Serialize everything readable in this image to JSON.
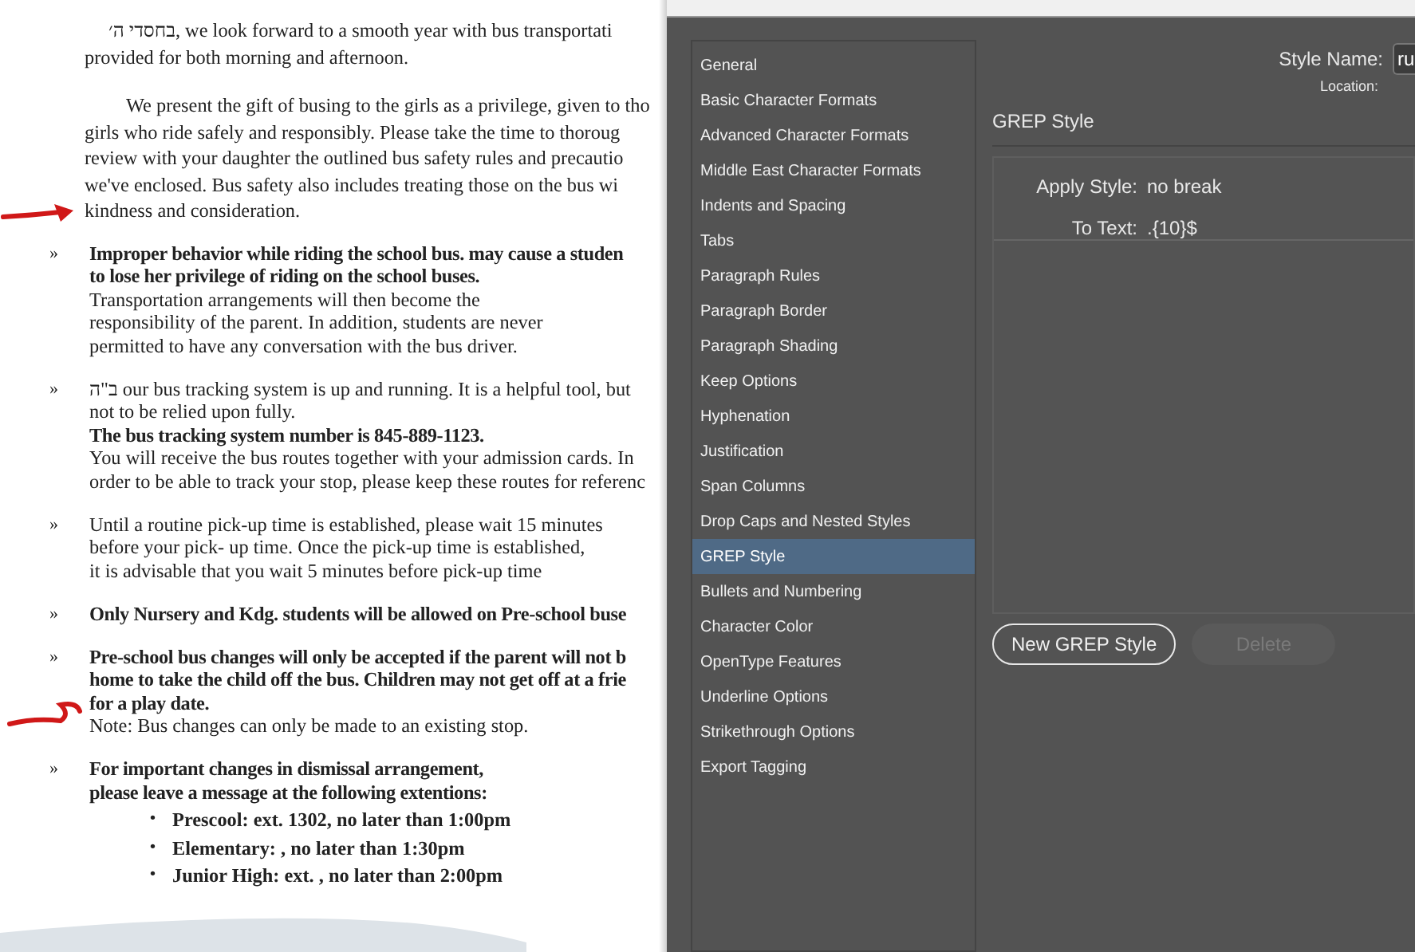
{
  "document": {
    "paragraphs": [
      {
        "lines": [
          "בחסדי ה׳, we look forward to a smooth year with bus transportati",
          "provided for both morning and afternoon."
        ]
      },
      {
        "lines": [
          "We present the gift of busing to the girls as a privilege, given to tho",
          "girls who ride safely and responsibly.  Please take the time to thoroug",
          "review with your daughter the outlined bus safety rules and precautio",
          "we've enclosed. Bus safety also includes treating those on the bus wi",
          "kindness and consideration."
        ]
      }
    ],
    "items": [
      {
        "marker": "»",
        "lines": [
          {
            "text": "Improper behavior while riding the school bus. may cause a studen",
            "bold": true
          },
          {
            "text": "to lose her privilege of riding on the school buses.",
            "bold": true
          },
          {
            "text": "Transportation arrangements will then become the",
            "bold": false
          },
          {
            "text": "responsibility of the parent.  In addition, students are never",
            "bold": false
          },
          {
            "text": "permitted to have any conversation with the bus driver.",
            "bold": false
          }
        ]
      },
      {
        "marker": "»",
        "lines": [
          {
            "text": "ב\"ה our bus tracking system is up and running. It is a helpful tool, but",
            "bold": false
          },
          {
            "text": "not to be relied upon fully.",
            "bold": false
          },
          {
            "text": "The bus tracking system number is 845-889-1123.",
            "bold": true
          },
          {
            "text": "You will receive the bus routes together with your admission cards.  In",
            "bold": false
          },
          {
            "text": "order to be able to track your stop, please keep these routes for referenc",
            "bold": false
          }
        ]
      },
      {
        "marker": "»",
        "lines": [
          {
            "text": "Until a routine pick-up time is established, please wait 15 minutes",
            "bold": false
          },
          {
            "text": "before your pick- up time.  Once the pick-up time is established,",
            "bold": false
          },
          {
            "text": "it is advisable that you wait 5 minutes before pick-up time",
            "bold": false
          }
        ]
      },
      {
        "marker": "»",
        "lines": [
          {
            "text": "Only Nursery and Kdg. students will be allowed on Pre-school buse",
            "bold": true
          }
        ]
      },
      {
        "marker": "»",
        "lines": [
          {
            "text": "Pre-school bus changes will only be accepted if the parent will not b",
            "bold": true
          },
          {
            "text": "home to take the child off the bus. Children may not get off at a frie",
            "bold": true
          },
          {
            "text": "for a play date.",
            "bold": true
          },
          {
            "text": "Note: Bus changes can only be made to an existing stop.",
            "bold": false
          }
        ]
      },
      {
        "marker": "»",
        "lines": [
          {
            "text": "For important changes in dismissal arrangement,",
            "bold": true
          },
          {
            "text": "please leave a message at the following extentions:",
            "bold": true
          }
        ],
        "sub_items": [
          {
            "marker": "•",
            "text": "Prescool: ext. 1302, no later than 1:00pm"
          },
          {
            "marker": "•",
            "text": "Elementary: , no later than 1:30pm"
          },
          {
            "marker": "•",
            "text": "Junior High: ext. , no later than 2:00pm"
          }
        ]
      }
    ]
  },
  "dialog": {
    "categories": [
      {
        "label": "General",
        "selected": false
      },
      {
        "label": "Basic Character Formats",
        "selected": false
      },
      {
        "label": "Advanced Character Formats",
        "selected": false
      },
      {
        "label": "Middle East Character Formats",
        "selected": false
      },
      {
        "label": "Indents and Spacing",
        "selected": false
      },
      {
        "label": "Tabs",
        "selected": false
      },
      {
        "label": "Paragraph Rules",
        "selected": false
      },
      {
        "label": "Paragraph Border",
        "selected": false
      },
      {
        "label": "Paragraph Shading",
        "selected": false
      },
      {
        "label": "Keep Options",
        "selected": false
      },
      {
        "label": "Hyphenation",
        "selected": false
      },
      {
        "label": "Justification",
        "selected": false
      },
      {
        "label": "Span Columns",
        "selected": false
      },
      {
        "label": "Drop Caps and Nested Styles",
        "selected": false
      },
      {
        "label": "GREP Style",
        "selected": true
      },
      {
        "label": "Bullets and Numbering",
        "selected": false
      },
      {
        "label": "Character Color",
        "selected": false
      },
      {
        "label": "OpenType Features",
        "selected": false
      },
      {
        "label": "Underline Options",
        "selected": false
      },
      {
        "label": "Strikethrough Options",
        "selected": false
      },
      {
        "label": "Export Tagging",
        "selected": false
      }
    ],
    "style_name_label": "Style Name:",
    "style_name_value": "ru",
    "location_label": "Location:",
    "section_title": "GREP Style",
    "rule": {
      "apply_label": "Apply Style:",
      "apply_value": "no break",
      "text_label": "To Text:",
      "text_value": ".{10}$"
    },
    "buttons": [
      {
        "label": "New GREP Style",
        "disabled": false
      },
      {
        "label": "Delete",
        "disabled": true
      }
    ]
  }
}
